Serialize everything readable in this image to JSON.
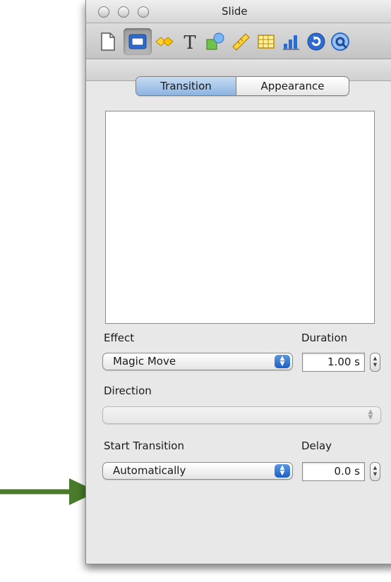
{
  "window": {
    "title": "Slide"
  },
  "toolbar": {
    "icons": [
      "document-icon",
      "slide-icon",
      "transition-icon",
      "text-icon",
      "shapes-icon",
      "ruler-icon",
      "table-icon",
      "chart-icon",
      "link-icon",
      "quicktime-icon"
    ],
    "selected": "slide-icon"
  },
  "tabs": {
    "transition": "Transition",
    "appearance": "Appearance",
    "active": "transition"
  },
  "effect": {
    "label": "Effect",
    "value": "Magic Move"
  },
  "duration": {
    "label": "Duration",
    "value": "1.00 s"
  },
  "direction": {
    "label": "Direction",
    "value": ""
  },
  "start_transition": {
    "label": "Start Transition",
    "value": "Automatically"
  },
  "delay": {
    "label": "Delay",
    "value": "0.0 s"
  },
  "colors": {
    "accent": "#2d6bcf",
    "tab_active": "#a8c8ec",
    "arrow": "#4a7a2b"
  }
}
